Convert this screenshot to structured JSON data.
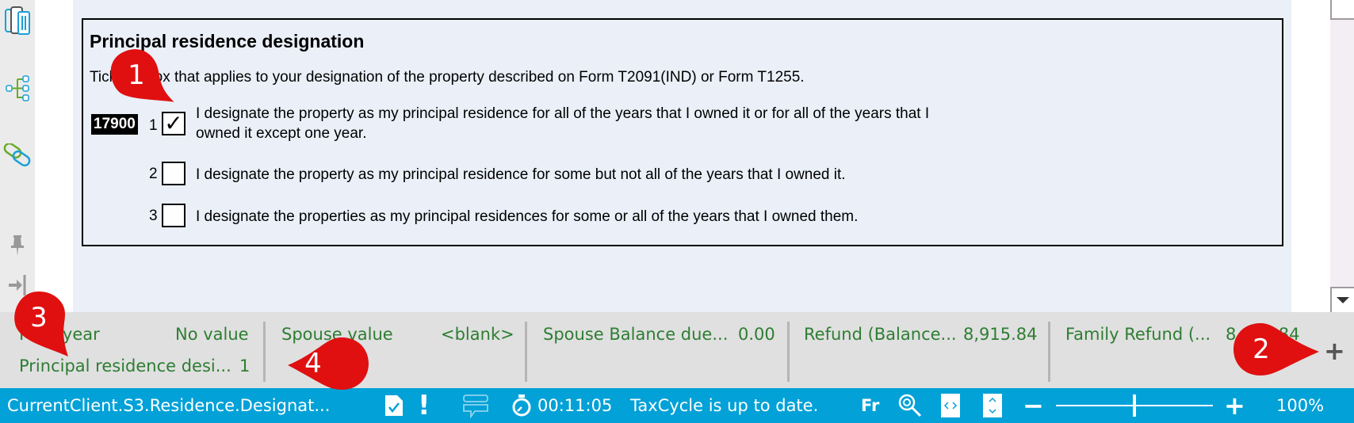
{
  "sidebar": {
    "icons": [
      {
        "name": "forms-icon"
      },
      {
        "name": "tree-icon"
      },
      {
        "name": "link-icon"
      },
      {
        "name": "pin-icon"
      },
      {
        "name": "collapse-icon"
      }
    ]
  },
  "form": {
    "title": "Principal residence designation",
    "intro": "Tick the box that applies to your designation of the property described on Form T2091(IND) or Form T1255.",
    "line_code": "17900",
    "options": [
      {
        "num": "1",
        "checked": true,
        "check_glyph": "✓",
        "text_line1": "I designate the property as my principal residence for all of the years that I owned it or for all of the years that I",
        "text_line2": "owned it except one year."
      },
      {
        "num": "2",
        "checked": false,
        "text_line1": "I designate the property as my principal residence for some but not all of the years that I owned it."
      },
      {
        "num": "3",
        "checked": false,
        "text_line1": "I designate the properties as my principal residences for some or all of the years that I owned them."
      }
    ]
  },
  "info_panel": {
    "cells": [
      {
        "label": "Prior year",
        "value": "No value"
      },
      {
        "label": "Spouse value",
        "value": "<blank>"
      },
      {
        "label": "Spouse Balance due...",
        "value": "0.00"
      },
      {
        "label": "Refund (Balance...",
        "value": "8,915.84"
      },
      {
        "label": "Family Refund (...",
        "value": "8,915.84"
      }
    ],
    "row2": {
      "label": "Principal residence desi...",
      "value": "1"
    },
    "add_label": "+"
  },
  "status_bar": {
    "path": "CurrentClient.S3.Residence.Designat...",
    "alert_glyph": "!",
    "timer": "00:11:05",
    "update_status": "TaxCycle is up to date.",
    "language": "Fr",
    "zoom_minus": "−",
    "zoom_plus": "+",
    "zoom_level": "100%",
    "zoom_fraction": 0.5
  },
  "callouts": [
    {
      "num": "1"
    },
    {
      "num": "2"
    },
    {
      "num": "3"
    },
    {
      "num": "4"
    }
  ],
  "colors": {
    "status_bar": "#02a1d7",
    "info_text": "#2e7d32",
    "callout": "#e01010",
    "page_bg": "#eaeff8"
  }
}
